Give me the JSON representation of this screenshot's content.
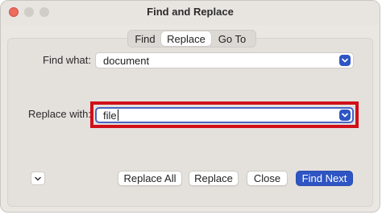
{
  "window": {
    "title": "Find and Replace",
    "accent_color": "#2f55c4",
    "highlight_color": "#d0101a"
  },
  "tabs": [
    {
      "label": "Find",
      "selected": false
    },
    {
      "label": "Replace",
      "selected": true
    },
    {
      "label": "Go To",
      "selected": false
    }
  ],
  "find": {
    "label": "Find what:",
    "value": "document"
  },
  "replace": {
    "label": "Replace with:",
    "value": "file"
  },
  "buttons": {
    "replace_all": "Replace All",
    "replace": "Replace",
    "close": "Close",
    "find_next": "Find Next"
  },
  "icons": {
    "find_dropdown": "chevron-down-icon",
    "replace_dropdown": "chevron-down-icon",
    "more_options": "chevron-down-icon"
  }
}
